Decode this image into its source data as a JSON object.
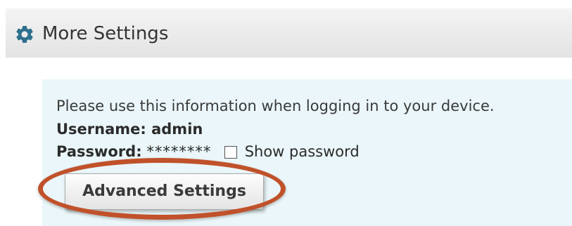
{
  "header": {
    "icon": "gear-icon",
    "title": "More Settings"
  },
  "info": {
    "intro": "Please use this information when logging in to your device.",
    "username_line": "Username: admin",
    "password_label": "Password:",
    "password_value": "********",
    "show_password_label": "Show password",
    "show_password_checked": false
  },
  "actions": {
    "advanced_settings_label": "Advanced Settings"
  },
  "colors": {
    "icon": "#2d6f8d",
    "panel_background": "#eaf6f9",
    "highlight": "#c0512a"
  }
}
